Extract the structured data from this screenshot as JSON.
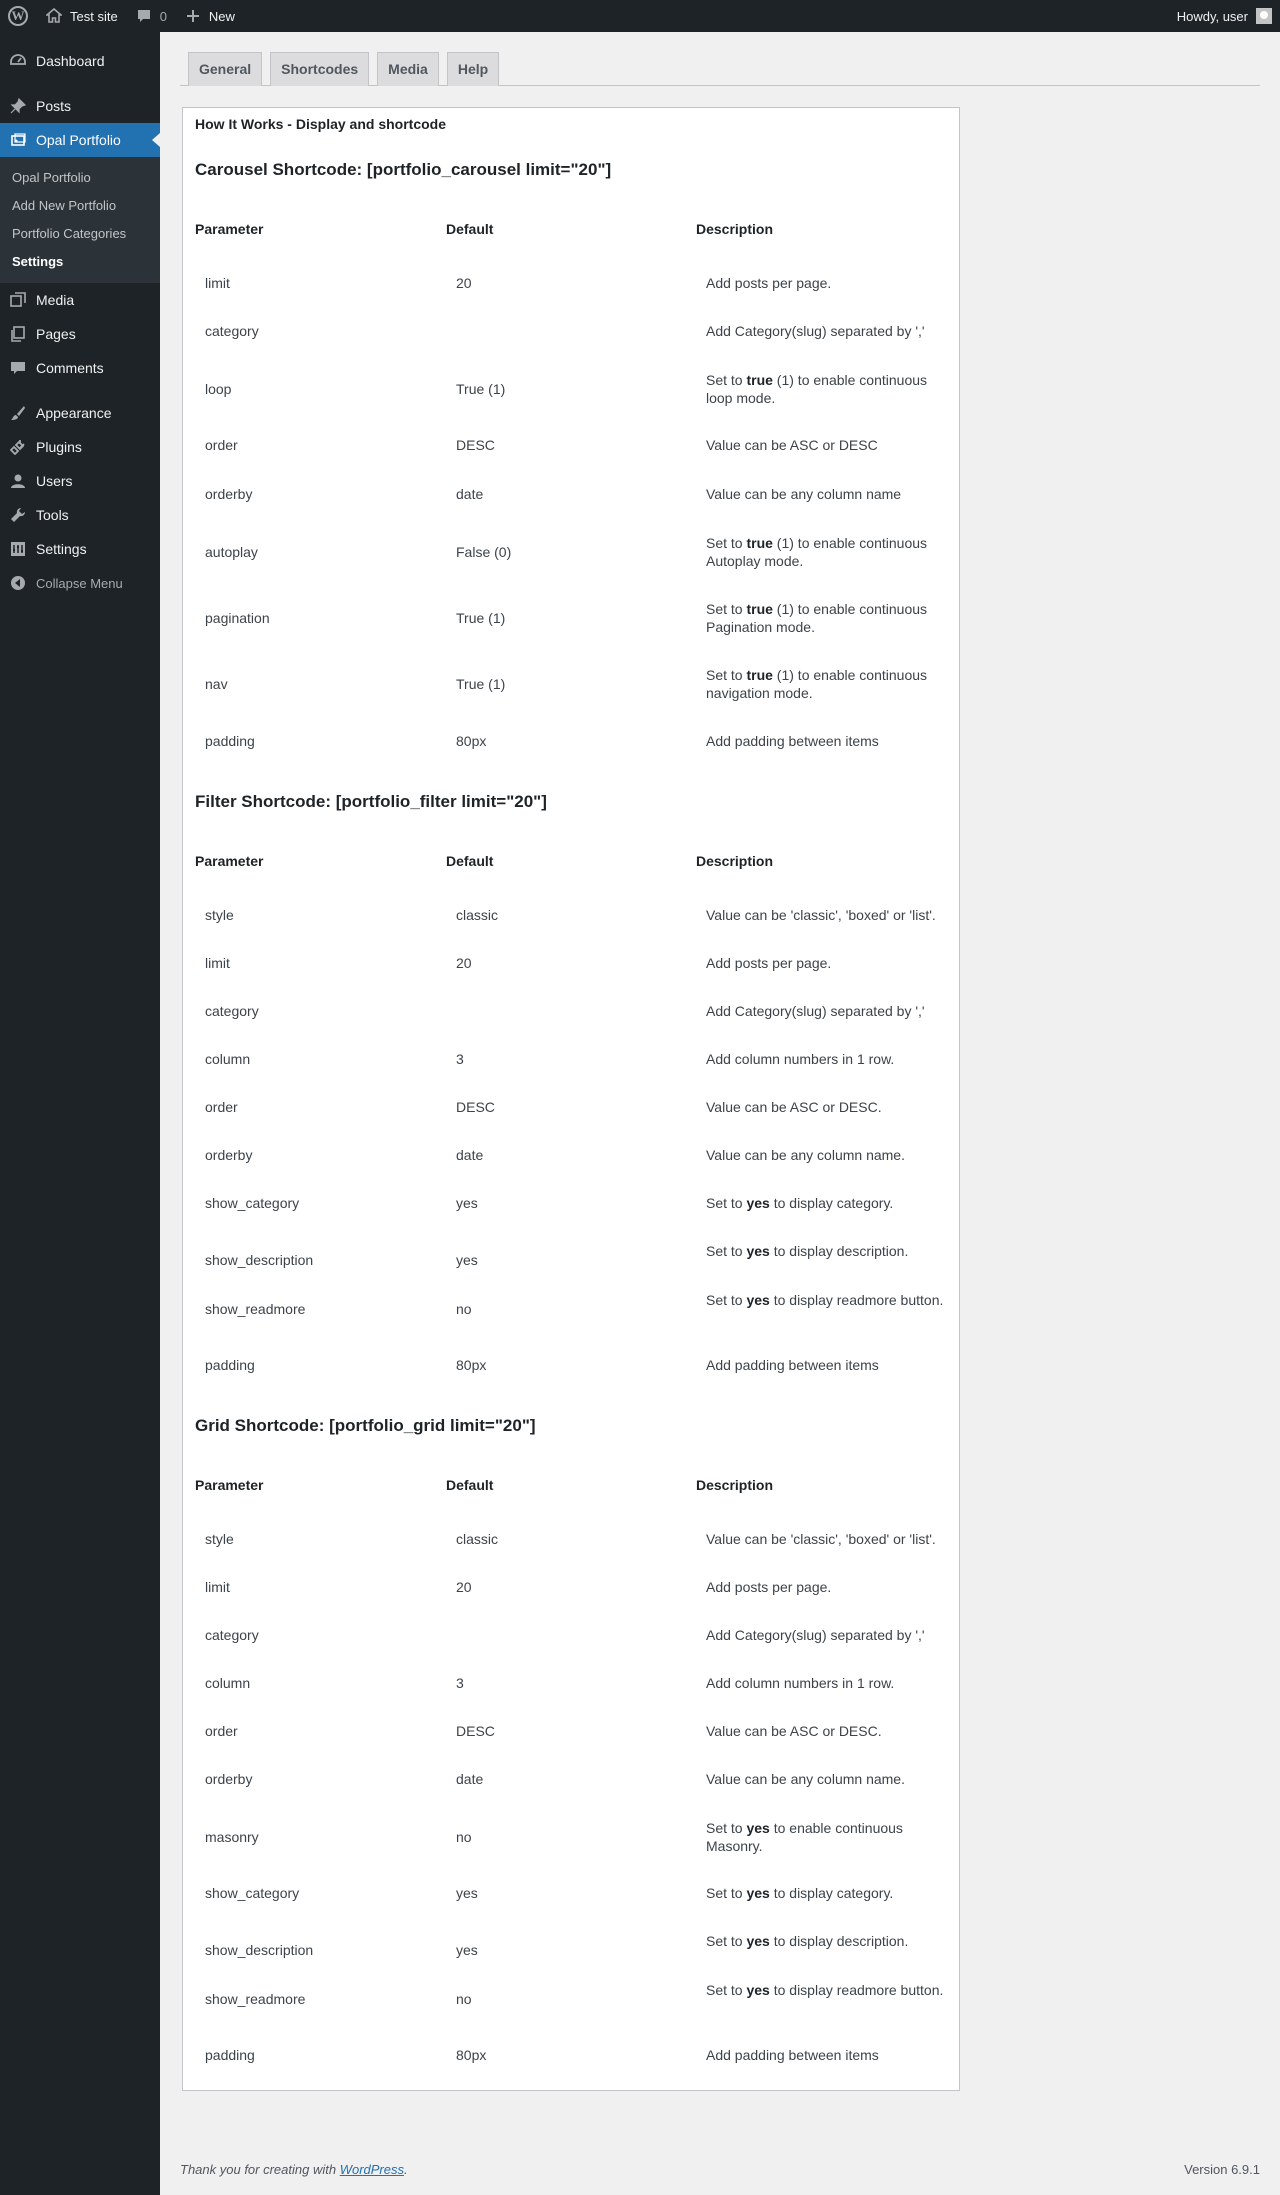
{
  "adminbar": {
    "site_name": "Test site",
    "comments_count": "0",
    "new_label": "New",
    "greeting": "Howdy, user"
  },
  "sidebar": {
    "items": [
      {
        "label": "Dashboard",
        "icon": "dashboard-icon"
      },
      {
        "label": "Posts",
        "icon": "pin-icon"
      },
      {
        "label": "Opal Portfolio",
        "icon": "portfolio-icon"
      },
      {
        "label": "Media",
        "icon": "media-icon"
      },
      {
        "label": "Pages",
        "icon": "pages-icon"
      },
      {
        "label": "Comments",
        "icon": "comments-icon"
      },
      {
        "label": "Appearance",
        "icon": "brush-icon"
      },
      {
        "label": "Plugins",
        "icon": "plugin-icon"
      },
      {
        "label": "Users",
        "icon": "users-icon"
      },
      {
        "label": "Tools",
        "icon": "wrench-icon"
      },
      {
        "label": "Settings",
        "icon": "settings-icon"
      }
    ],
    "submenu": [
      "Opal Portfolio",
      "Add New Portfolio",
      "Portfolio Categories",
      "Settings"
    ],
    "collapse_label": "Collapse Menu"
  },
  "tabs": [
    "General",
    "Shortcodes",
    "Media",
    "Help"
  ],
  "panel": {
    "heading": "How It Works - Display and shortcode",
    "col_parameter": "Parameter",
    "col_default": "Default",
    "col_description": "Description"
  },
  "sections": [
    {
      "title": "Carousel Shortcode: [portfolio_carousel limit=\"20\"]",
      "rows": [
        {
          "param": "limit",
          "default": "20",
          "desc_pre": "Add posts per page.",
          "bold": "",
          "desc_post": ""
        },
        {
          "param": "category",
          "default": "",
          "desc_pre": "Add Category(slug) separated by ','",
          "bold": "",
          "desc_post": ""
        },
        {
          "param": "loop",
          "default": "True (1)",
          "desc_pre": "Set to ",
          "bold": "true",
          "desc_post": " (1) to enable continuous loop mode."
        },
        {
          "param": "order",
          "default": "DESC",
          "desc_pre": "Value can be ASC or DESC",
          "bold": "",
          "desc_post": ""
        },
        {
          "param": "orderby",
          "default": "date",
          "desc_pre": "Value can be any column name",
          "bold": "",
          "desc_post": ""
        },
        {
          "param": "autoplay",
          "default": "False (0)",
          "desc_pre": "Set to ",
          "bold": "true",
          "desc_post": " (1) to enable continuous Autoplay mode."
        },
        {
          "param": "pagination",
          "default": "True (1)",
          "desc_pre": "Set to ",
          "bold": "true",
          "desc_post": " (1) to enable continuous Pagination mode."
        },
        {
          "param": "nav",
          "default": "True (1)",
          "desc_pre": "Set to ",
          "bold": "true",
          "desc_post": " (1) to enable continuous navigation mode."
        },
        {
          "param": "padding",
          "default": "80px",
          "desc_pre": "Add padding between items",
          "bold": "",
          "desc_post": ""
        }
      ]
    },
    {
      "title": "Filter Shortcode: [portfolio_filter limit=\"20\"]",
      "rows": [
        {
          "param": "style",
          "default": "classic",
          "desc_pre": "Value can be 'classic', 'boxed' or 'list'.",
          "bold": "",
          "desc_post": ""
        },
        {
          "param": "limit",
          "default": "20",
          "desc_pre": "Add posts per page.",
          "bold": "",
          "desc_post": ""
        },
        {
          "param": "category",
          "default": "",
          "desc_pre": "Add Category(slug) separated by ','",
          "bold": "",
          "desc_post": ""
        },
        {
          "param": "column",
          "default": "3",
          "desc_pre": "Add column numbers in 1 row.",
          "bold": "",
          "desc_post": ""
        },
        {
          "param": "order",
          "default": "DESC",
          "desc_pre": "Value can be ASC or DESC.",
          "bold": "",
          "desc_post": ""
        },
        {
          "param": "orderby",
          "default": "date",
          "desc_pre": "Value can be any column name.",
          "bold": "",
          "desc_post": ""
        },
        {
          "param": "show_category",
          "default": "yes",
          "desc_pre": "Set to ",
          "bold": "yes",
          "desc_post": " to display category."
        },
        {
          "param": "show_description",
          "default": "yes",
          "desc_pre": "Set to ",
          "bold": "yes",
          "desc_post": " to display description."
        },
        {
          "param": "show_readmore",
          "default": "no",
          "desc_pre": "Set to ",
          "bold": "yes",
          "desc_post": " to display readmore button."
        },
        {
          "param": "padding",
          "default": "80px",
          "desc_pre": "Add padding between items",
          "bold": "",
          "desc_post": ""
        }
      ]
    },
    {
      "title": "Grid Shortcode: [portfolio_grid limit=\"20\"]",
      "rows": [
        {
          "param": "style",
          "default": "classic",
          "desc_pre": "Value can be 'classic', 'boxed' or 'list'.",
          "bold": "",
          "desc_post": ""
        },
        {
          "param": "limit",
          "default": "20",
          "desc_pre": "Add posts per page.",
          "bold": "",
          "desc_post": ""
        },
        {
          "param": "category",
          "default": "",
          "desc_pre": "Add Category(slug) separated by ','",
          "bold": "",
          "desc_post": ""
        },
        {
          "param": "column",
          "default": "3",
          "desc_pre": "Add column numbers in 1 row.",
          "bold": "",
          "desc_post": ""
        },
        {
          "param": "order",
          "default": "DESC",
          "desc_pre": "Value can be ASC or DESC.",
          "bold": "",
          "desc_post": ""
        },
        {
          "param": "orderby",
          "default": "date",
          "desc_pre": "Value can be any column name.",
          "bold": "",
          "desc_post": ""
        },
        {
          "param": "masonry",
          "default": "no",
          "desc_pre": "Set to ",
          "bold": "yes",
          "desc_post": " to enable continuous Masonry."
        },
        {
          "param": "show_category",
          "default": "yes",
          "desc_pre": "Set to ",
          "bold": "yes",
          "desc_post": " to display category."
        },
        {
          "param": "show_description",
          "default": "yes",
          "desc_pre": "Set to ",
          "bold": "yes",
          "desc_post": " to display description."
        },
        {
          "param": "show_readmore",
          "default": "no",
          "desc_pre": "Set to ",
          "bold": "yes",
          "desc_post": " to display readmore button."
        },
        {
          "param": "padding",
          "default": "80px",
          "desc_pre": "Add padding between items",
          "bold": "",
          "desc_post": ""
        }
      ]
    }
  ],
  "footer": {
    "thanks_pre": "Thank you for creating with ",
    "link": "WordPress",
    "thanks_post": ".",
    "version": "Version 6.9.1"
  }
}
